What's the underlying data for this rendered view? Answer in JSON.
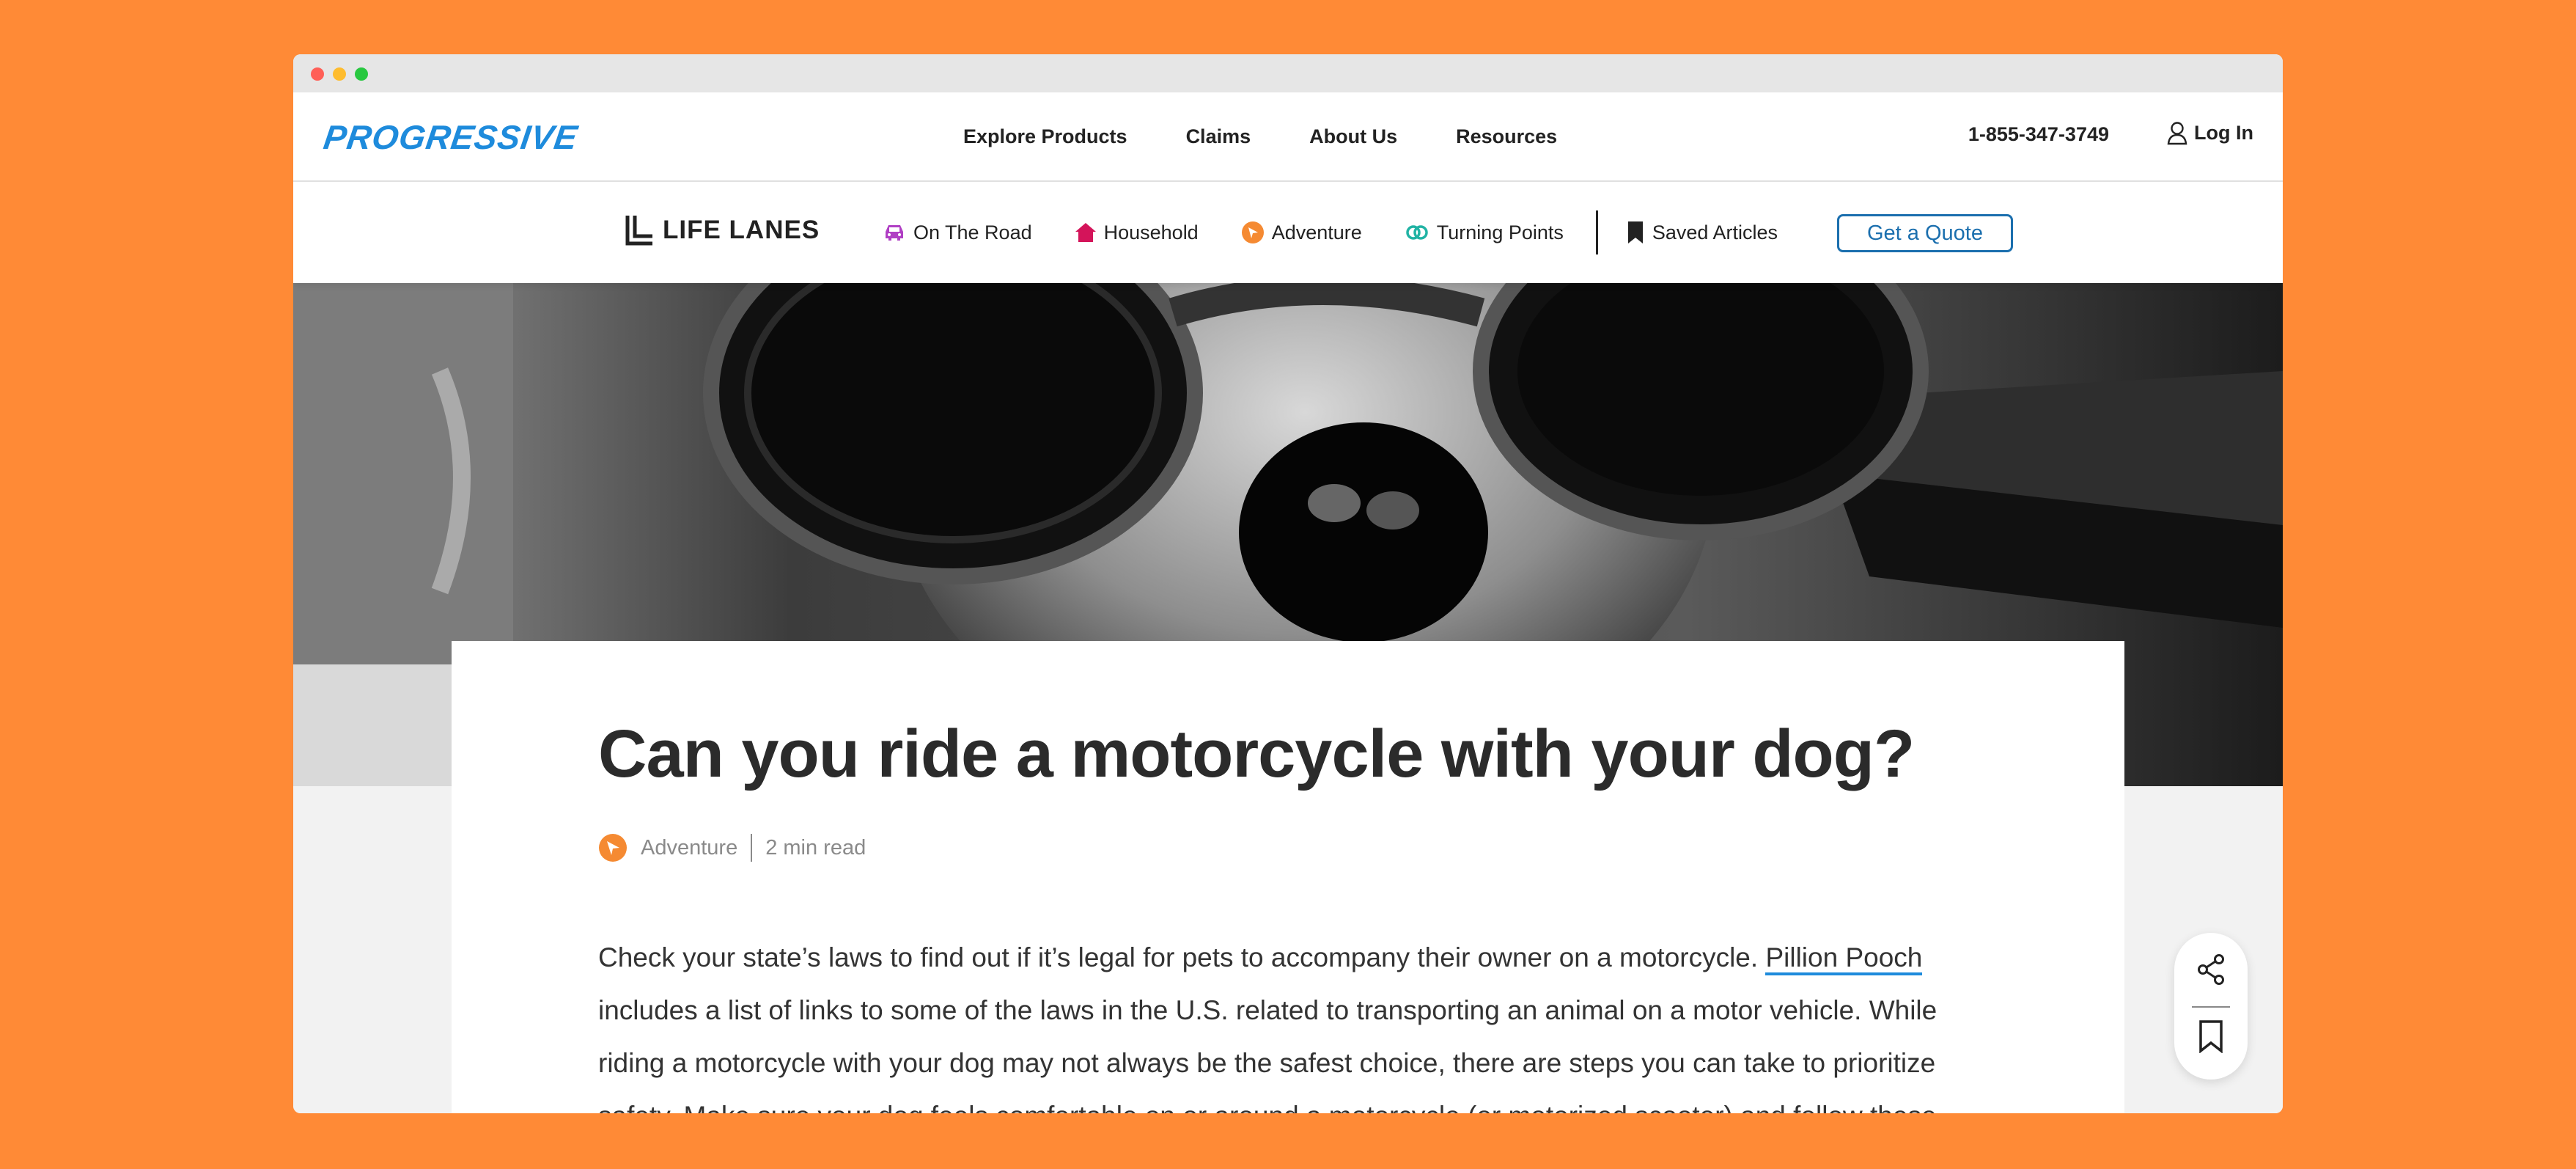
{
  "site": {
    "logo": "PROGRESSIVE",
    "nav": [
      "Explore Products",
      "Claims",
      "About Us",
      "Resources"
    ],
    "phone": "1-855-347-3749",
    "login_label": "Log In"
  },
  "subnav": {
    "brand": "LIFE LANES",
    "items": [
      {
        "label": "On The Road",
        "icon": "car-icon",
        "color": "#b03fc4"
      },
      {
        "label": "Household",
        "icon": "house-icon",
        "color": "#d4145a"
      },
      {
        "label": "Adventure",
        "icon": "compass-icon",
        "color": "#f58a32"
      },
      {
        "label": "Turning Points",
        "icon": "rings-icon",
        "color": "#21b3a4"
      }
    ],
    "saved_label": "Saved Articles",
    "quote_label": "Get a Quote"
  },
  "article": {
    "title": "Can you ride a motorcycle with your dog?",
    "category": "Adventure",
    "read_time": "2 min read",
    "paragraph_before_link": "Check your state’s laws to find out if it’s legal for pets to accompany their owner on a motorcycle. ",
    "link_text": "Pillion Pooch",
    "paragraph_after_link": " includes a list of links to some of the laws in the U.S. related to transporting an animal on a motor vehicle. While riding a motorcycle with your dog may not always be the safest choice, there are steps you can take to prioritize safety. Make sure your dog feels comfortable on or around a motorcycle (or motorized scooter) and follow these"
  },
  "colors": {
    "background": "#ff8a36",
    "brand_blue": "#1e8bdc",
    "quote_blue": "#1b6fae",
    "adventure_orange": "#f58a32"
  }
}
